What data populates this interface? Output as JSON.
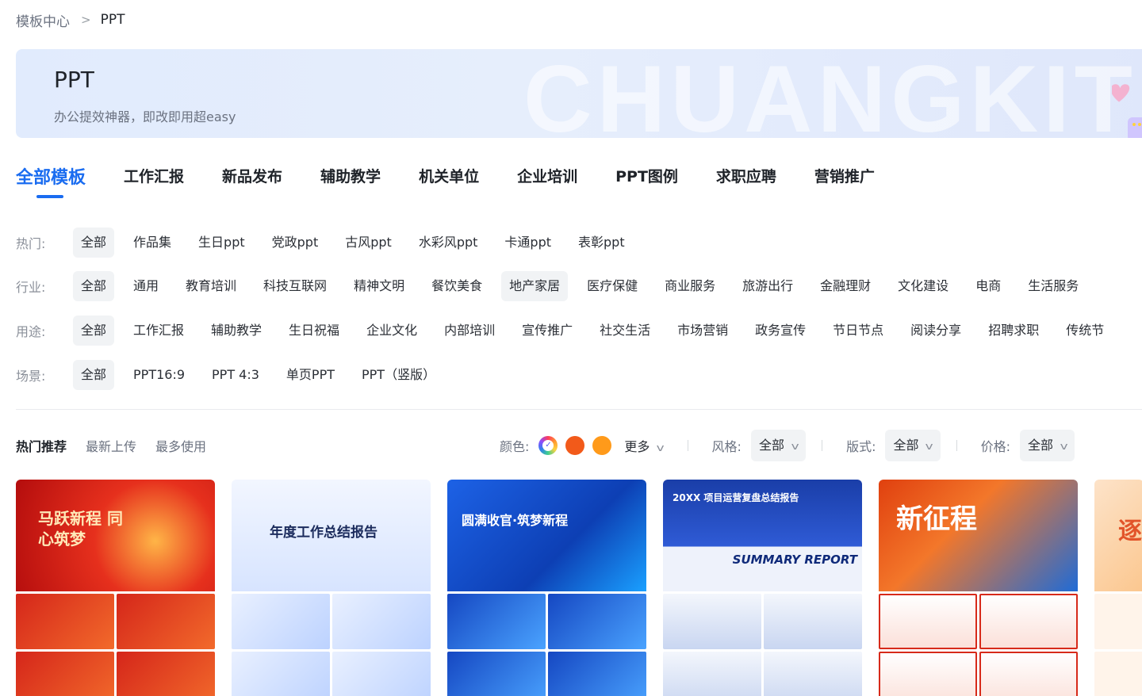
{
  "breadcrumb": {
    "parent": "模板中心",
    "separator": ">",
    "current": "PPT"
  },
  "banner": {
    "title": "PPT",
    "subtitle": "办公提效神器，即改即用超easy",
    "watermark": "CHUANGKIT"
  },
  "tabs": [
    {
      "label": "全部模板",
      "active": true
    },
    {
      "label": "工作汇报"
    },
    {
      "label": "新品发布"
    },
    {
      "label": "辅助教学"
    },
    {
      "label": "机关单位"
    },
    {
      "label": "企业培训"
    },
    {
      "label": "PPT图例"
    },
    {
      "label": "求职应聘"
    },
    {
      "label": "营销推广"
    }
  ],
  "filters": {
    "hot": {
      "label": "热门:",
      "options": [
        "全部",
        "作品集",
        "生日ppt",
        "党政ppt",
        "古风ppt",
        "水彩风ppt",
        "卡通ppt",
        "表彰ppt"
      ],
      "selected": "全部"
    },
    "industry": {
      "label": "行业:",
      "options": [
        "全部",
        "通用",
        "教育培训",
        "科技互联网",
        "精神文明",
        "餐饮美食",
        "地产家居",
        "医疗保健",
        "商业服务",
        "旅游出行",
        "金融理财",
        "文化建设",
        "电商",
        "生活服务"
      ],
      "selected": "全部",
      "hovered": "地产家居"
    },
    "usage": {
      "label": "用途:",
      "options": [
        "全部",
        "工作汇报",
        "辅助教学",
        "生日祝福",
        "企业文化",
        "内部培训",
        "宣传推广",
        "社交生活",
        "市场营销",
        "政务宣传",
        "节日节点",
        "阅读分享",
        "招聘求职",
        "传统节"
      ],
      "selected": "全部"
    },
    "scene": {
      "label": "场景:",
      "options": [
        "全部",
        "PPT16:9",
        "PPT 4:3",
        "单页PPT",
        "PPT（竖版）"
      ],
      "selected": "全部"
    }
  },
  "sort": {
    "items": [
      "热门推荐",
      "最新上传",
      "最多使用"
    ],
    "active": "热门推荐"
  },
  "toolbar": {
    "color_label": "颜色:",
    "colors": [
      "#ff3b5c",
      "#f25a1a",
      "#ff9a1a"
    ],
    "more_label": "更多",
    "style_label": "风格:",
    "style_value": "全部",
    "layout_label": "版式:",
    "layout_value": "全部",
    "price_label": "价格:",
    "price_value": "全部"
  },
  "cards": [
    {
      "title": "马跃新程 同心筑梦"
    },
    {
      "title": "年度工作总结报告"
    },
    {
      "title": "圆满收官·筑梦新程"
    },
    {
      "title": "20XX 项目运营复盘总结报告",
      "title_en": "SUMMARY REPORT"
    },
    {
      "title": "新征程"
    },
    {
      "title": "逐"
    }
  ]
}
